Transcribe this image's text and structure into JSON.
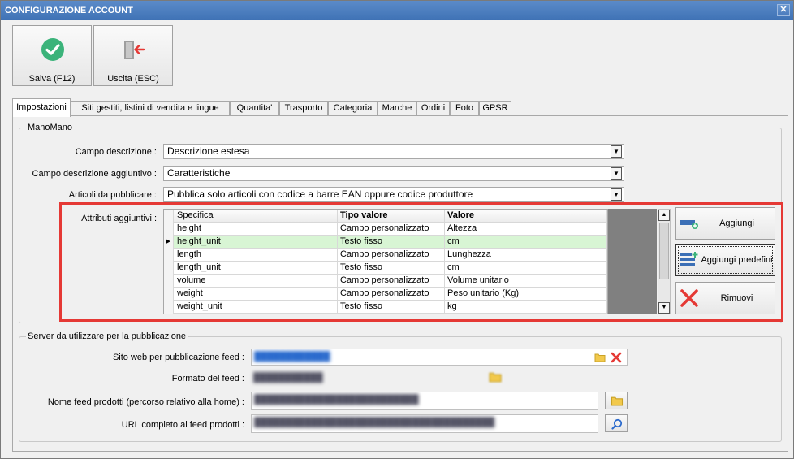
{
  "window": {
    "title": "CONFIGURAZIONE ACCOUNT",
    "close_glyph": "✕"
  },
  "toolbar": {
    "save_label": "Salva (F12)",
    "exit_label": "Uscita (ESC)",
    "save_icon": "check-circle-icon",
    "exit_icon": "exit-door-icon"
  },
  "tabs": [
    "Impostazioni",
    "Siti gestiti, listini di vendita e lingue",
    "Quantita'",
    "Trasporto",
    "Categoria",
    "Marche",
    "Ordini",
    "Foto",
    "GPSR"
  ],
  "active_tab": "Impostazioni",
  "manomano": {
    "group_title": "ManoMano",
    "campo_descrizione": {
      "label": "Campo descrizione :",
      "value": "Descrizione estesa"
    },
    "campo_aggiuntivo": {
      "label": "Campo descrizione aggiuntivo :",
      "value": "Caratteristiche"
    },
    "articoli": {
      "label": "Articoli da pubblicare :",
      "value": "Pubblica solo articoli con codice a barre EAN oppure codice produttore"
    },
    "attributi_label": "Attributi aggiuntivi :",
    "grid": {
      "columns": [
        "Specifica",
        "Tipo valore",
        "Valore"
      ],
      "rows": [
        {
          "specifica": "height",
          "tipo": "Campo personalizzato",
          "valore": "Altezza"
        },
        {
          "specifica": "height_unit",
          "tipo": "Testo fisso",
          "valore": "cm"
        },
        {
          "specifica": "length",
          "tipo": "Campo personalizzato",
          "valore": "Lunghezza"
        },
        {
          "specifica": "length_unit",
          "tipo": "Testo fisso",
          "valore": "cm"
        },
        {
          "specifica": "volume",
          "tipo": "Campo personalizzato",
          "valore": "Volume unitario"
        },
        {
          "specifica": "weight",
          "tipo": "Campo personalizzato",
          "valore": "Peso unitario (Kg)"
        },
        {
          "specifica": "weight_unit",
          "tipo": "Testo fisso",
          "valore": "kg"
        }
      ],
      "selected_row": "height_unit",
      "row_marker": "▶"
    },
    "buttons": {
      "aggiungi": "Aggiungi",
      "aggiungi_predefiniti": "Aggiungi predefini",
      "rimuovi": "Rimuovi"
    }
  },
  "server": {
    "group_title": "Server da utilizzare per la pubblicazione",
    "sito_web": {
      "label": "Sito web per pubblicazione feed :",
      "value": ""
    },
    "formato_feed": {
      "label": "Formato del feed :",
      "value": ""
    },
    "nome_feed": {
      "label": "Nome feed prodotti (percorso relativo alla home) :",
      "value": ""
    },
    "url_feed": {
      "label": "URL completo al feed prodotti :",
      "value": ""
    }
  },
  "colors": {
    "titlebar": "#4a7bbd",
    "selected_row": "#d8f5d4",
    "highlight_frame": "#e53935",
    "check_green": "#3bb37a"
  }
}
